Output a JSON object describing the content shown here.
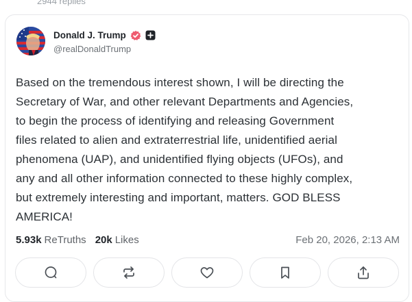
{
  "previous_thread": {
    "replies_label": "2944 replies"
  },
  "post": {
    "author": {
      "display_name": "Donald J. Trump",
      "handle": "@realDonaldTrump"
    },
    "text_lines": [
      "Based on the tremendous interest shown, I will be directing the",
      "Secretary of War, and other relevant Departments and Agencies,",
      "to begin the process of identifying and releasing Government",
      "files related to alien and extraterrestrial life, unidentified aerial",
      "phenomena (UAP), and unidentified flying objects (UFOs), and",
      "any and all other information connected to these highly complex,",
      "but extremely interesting and important, matters. GOD BLESS",
      "AMERICA!"
    ],
    "stats": {
      "retruths_count": "5.93k",
      "retruths_label": "ReTruths",
      "likes_count": "20k",
      "likes_label": "Likes"
    },
    "timestamp": "Feb 20, 2026, 2:13 AM"
  },
  "actions": {
    "icons": [
      "reply-icon",
      "retruth-icon",
      "like-icon",
      "bookmark-icon",
      "share-icon"
    ]
  },
  "colors": {
    "verified_badge": "#ef5b6f",
    "text_primary": "#1f2328",
    "text_secondary": "#6b7075",
    "border": "#e3e4e7"
  }
}
